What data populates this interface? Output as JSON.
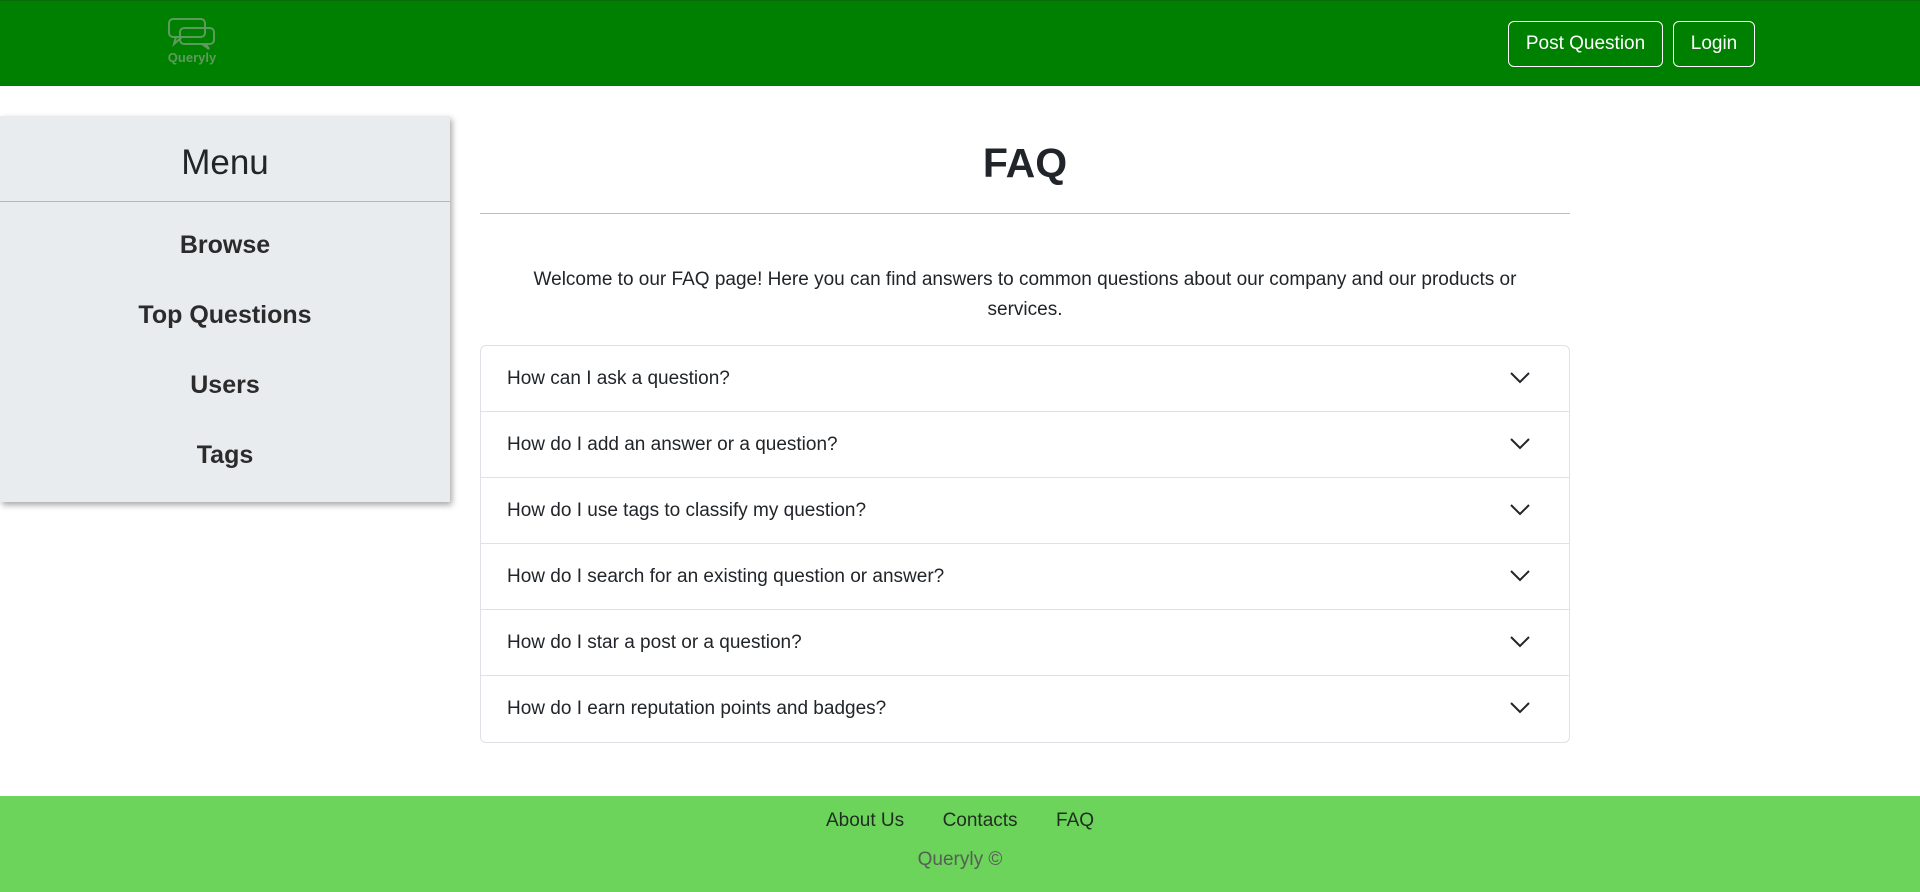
{
  "header": {
    "logo_text": "Queryly",
    "post_question_label": "Post Question",
    "login_label": "Login",
    "background_color": "#008000"
  },
  "sidebar": {
    "title": "Menu",
    "items": [
      {
        "label": "Browse"
      },
      {
        "label": "Top Questions"
      },
      {
        "label": "Users"
      },
      {
        "label": "Tags"
      }
    ]
  },
  "main": {
    "title": "FAQ",
    "intro": "Welcome to our FAQ page! Here you can find answers to common questions about our company and our products or services.",
    "faq": [
      {
        "question": "How can I ask a question?",
        "icon": "chevron-down-icon"
      },
      {
        "question": "How do I add an answer or a question?",
        "icon": "chevron-down-icon"
      },
      {
        "question": "How do I use tags to classify my question?",
        "icon": "chevron-down-icon"
      },
      {
        "question": "How do I search for an existing question or answer?",
        "icon": "chevron-down-icon"
      },
      {
        "question": "How do I star a post or a question?",
        "icon": "chevron-down-icon"
      },
      {
        "question": "How do I earn reputation points and badges?",
        "icon": "chevron-down-icon"
      }
    ]
  },
  "footer": {
    "links": [
      {
        "label": "About Us"
      },
      {
        "label": "Contacts"
      },
      {
        "label": "FAQ"
      }
    ],
    "copyright": "Queryly ©",
    "background_color": "#6cd35b"
  }
}
